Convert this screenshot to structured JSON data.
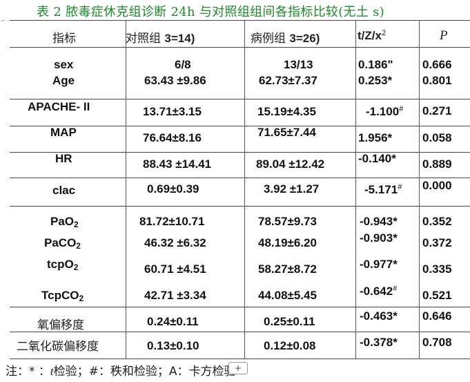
{
  "title": "表 2 脓毒症休克组诊断 24h 与对照组组间各指标比较(无土 s)",
  "headers": {
    "indicator": "指标",
    "control_label": "对照组",
    "control_n": "3=14)",
    "case_label": "病例组",
    "case_n": "3=26)",
    "stat": "t/Z/x",
    "stat_sup": "2",
    "p": "P"
  },
  "rows": [
    {
      "name": "sex",
      "control": "6/8",
      "case": "13/13",
      "stat": "0.186\"",
      "stat_mark": "",
      "p": "0.666"
    },
    {
      "name": "Age",
      "control": "63.43 ±9.86",
      "case": "62.73±7.37",
      "stat": "0.253*",
      "stat_mark": "",
      "p": "0.801"
    },
    {
      "name": "APACHE- II",
      "control": "13.71±3.15",
      "case": "15.19±4.35",
      "stat": "-1.100",
      "stat_mark": "#",
      "p": "0.271"
    },
    {
      "name": "MAP",
      "control": "76.64±8.16",
      "case": "71.65±7.44",
      "stat": "1.956*",
      "stat_mark": "",
      "p": "0.058"
    },
    {
      "name": "HR",
      "control": "88.43 ±14.41",
      "case": "89.04 ±12.42",
      "stat": "-0.140*",
      "stat_mark": "",
      "p": "0.889"
    },
    {
      "name": "clac",
      "control": "0.69±0.39",
      "case": "3.92 ±1.27",
      "stat": "-5.171",
      "stat_mark": "#",
      "p": "0.000"
    },
    {
      "name_base": "PaO",
      "name_sub": "2",
      "control": "81.72±10.71",
      "case": "78.57±9.73",
      "stat": "-0.943*",
      "stat_mark": "",
      "p": "0.352"
    },
    {
      "name_base": "PaCO",
      "name_sub": "2",
      "control": "46.32 ±6.32",
      "case": "48.19±6.20",
      "stat": "-0.903*",
      "stat_mark": "",
      "p": "0.372"
    },
    {
      "name_base": "tcpO",
      "name_sub": "2",
      "control": "60.71 ±4.51",
      "case": "58.27±8.72",
      "stat": "-0.977*",
      "stat_mark": "",
      "p": "0.335"
    },
    {
      "name_base": "TcpCO",
      "name_sub": "2",
      "control": "42.71 ±3.34",
      "case": "44.08±5.45",
      "stat": "-0.642",
      "stat_mark": "#",
      "p": "0.521"
    },
    {
      "name": "氧偏移度",
      "control": "0.24±0.11",
      "case": "0.25±0.11",
      "stat": "-0.463*",
      "stat_mark": "",
      "p": "0.646"
    },
    {
      "name": "二氧化碳偏移度",
      "control": "0.13±0.10",
      "case": "0.12±0.08",
      "stat": "-0.378*",
      "stat_mark": "",
      "p": "0.708"
    }
  ],
  "footnote": {
    "prefix": "注：* ：",
    "t_symbol": "t",
    "t_text": "检验；#：秩和检验；A：",
    "hidden": "卡方",
    "suffix": "检验"
  },
  "scroll_button": "+"
}
